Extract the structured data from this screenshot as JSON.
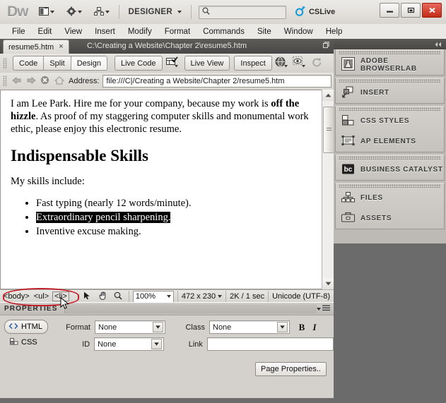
{
  "app": {
    "logo": "Dw",
    "workspace": "DESIGNER",
    "cslive": "CSLive",
    "search_placeholder": ""
  },
  "titlebar": {
    "icons": [
      "layout-switcher-icon",
      "gear-icon",
      "site-manager-icon"
    ],
    "window_buttons": [
      "minimize",
      "restore",
      "close"
    ]
  },
  "menubar": {
    "items": [
      {
        "label": "File"
      },
      {
        "label": "Edit"
      },
      {
        "label": "View"
      },
      {
        "label": "Insert"
      },
      {
        "label": "Modify"
      },
      {
        "label": "Format"
      },
      {
        "label": "Commands"
      },
      {
        "label": "Site"
      },
      {
        "label": "Window"
      },
      {
        "label": "Help"
      }
    ]
  },
  "document": {
    "tab_label": "resume5.htm",
    "tab_close": "×",
    "path": "C:\\Creating a Website\\Chapter 2\\resume5.htm"
  },
  "viewbar": {
    "view_buttons": [
      {
        "label": "Code",
        "selected": false
      },
      {
        "label": "Split",
        "selected": false
      },
      {
        "label": "Design",
        "selected": true
      }
    ],
    "live_code": "Live Code",
    "live_view": "Live View",
    "inspect": "Inspect",
    "icons": [
      "live-code-settings-icon",
      "browser-preview-icon",
      "visual-aids-icon",
      "refresh-icon"
    ]
  },
  "address": {
    "label": "Address:",
    "value": "file:///C|/Creating a Website/Chapter 2/resume5.htm",
    "nav_icons": [
      "back-icon",
      "forward-icon",
      "stop-icon",
      "home-icon"
    ]
  },
  "page": {
    "paragraph1_pre": "I am Lee Park. Hire me for your company, because my work is ",
    "paragraph1_bold": "off the hizzle",
    "paragraph1_post": ". As proof of my staggering computer skills and monumental work ethic, please enjoy this electronic resume.",
    "heading": "Indispensable Skills",
    "paragraph2": "My skills include:",
    "list_items": [
      {
        "text": "Fast typing (nearly 12 words/minute).",
        "selected": false
      },
      {
        "text": "Extraordinary pencil sharpening.",
        "selected": true
      },
      {
        "text": "Inventive excuse making.",
        "selected": false
      }
    ]
  },
  "statusbar": {
    "tags": [
      {
        "label": "<body>",
        "active": false
      },
      {
        "label": "<ul>",
        "active": false
      },
      {
        "label": "<li>",
        "active": true
      }
    ],
    "tools": [
      "select-tool-icon",
      "hand-tool-icon",
      "zoom-tool-icon"
    ],
    "zoom": "100%",
    "window_size": "472 x 230",
    "download_size": "2K / 1 sec",
    "encoding": "Unicode (UTF-8)"
  },
  "properties": {
    "title": "PROPERTIES",
    "html_button": "HTML",
    "css_button": "CSS",
    "format_label": "Format",
    "format_value": "None",
    "id_label": "ID",
    "id_value": "None",
    "class_label": "Class",
    "class_value": "None",
    "link_label": "Link",
    "link_value": "",
    "bold_label": "B",
    "italic_label": "I",
    "page_properties_button": "Page Properties.."
  },
  "dock": {
    "groups": [
      {
        "panels": [
          {
            "label": "ADOBE BROWSERLAB",
            "icon": "browserlab-icon"
          }
        ]
      },
      {
        "panels": [
          {
            "label": "INSERT",
            "icon": "insert-icon"
          }
        ]
      },
      {
        "panels": [
          {
            "label": "CSS STYLES",
            "icon": "css-styles-icon"
          },
          {
            "label": "AP ELEMENTS",
            "icon": "ap-elements-icon"
          }
        ]
      },
      {
        "panels": [
          {
            "label": "BUSINESS CATALYST",
            "icon": "business-catalyst-icon"
          }
        ]
      },
      {
        "panels": [
          {
            "label": "FILES",
            "icon": "files-icon"
          },
          {
            "label": "ASSETS",
            "icon": "assets-icon"
          }
        ]
      }
    ]
  },
  "annotation": {
    "color": "#c4202a",
    "shape": "ellipse",
    "target": "tag-selector"
  },
  "colors": {
    "titlebar": "#e8e6e2",
    "dock_background": "#6b6b6b",
    "close_button": "#c32a18",
    "annotation_red": "#c4202a",
    "selection": "#000000"
  }
}
